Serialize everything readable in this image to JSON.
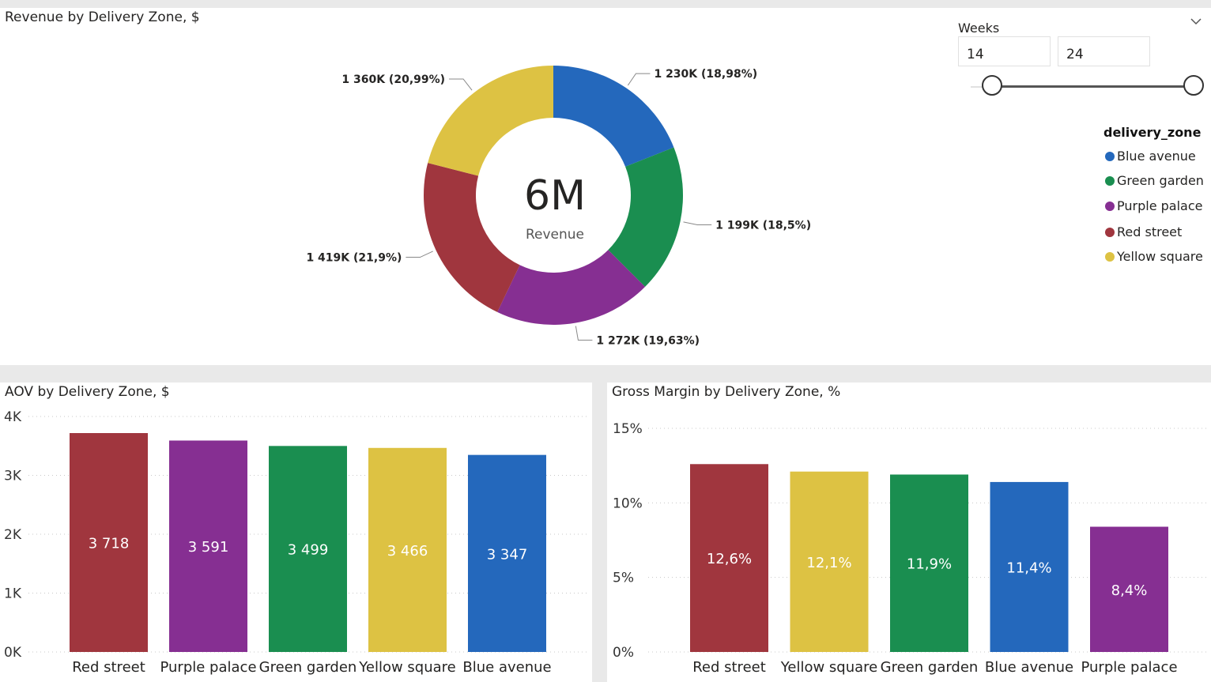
{
  "colors": {
    "blue": "#2468bc",
    "green": "#1a8e50",
    "purple": "#862f92",
    "red": "#a0363e",
    "yellow": "#ddc243"
  },
  "weeks_filter": {
    "title": "Weeks",
    "from": "14",
    "to": "24",
    "icon": "chevron-down-icon"
  },
  "legend": {
    "title": "delivery_zone",
    "items": [
      "Blue avenue",
      "Green garden",
      "Purple palace",
      "Red street",
      "Yellow square"
    ]
  },
  "chart_data": [
    {
      "type": "pie",
      "title": "Revenue by Delivery Zone, $",
      "center_value": "6M",
      "center_label": "Revenue",
      "categories": [
        "Blue avenue",
        "Green garden",
        "Purple palace",
        "Red street",
        "Yellow square"
      ],
      "values": [
        1230,
        1199,
        1272,
        1419,
        1360
      ],
      "unit": "K",
      "data_labels": [
        "1 230K (18,98%)",
        "1 199K (18,5%)",
        "1 272K (19,63%)",
        "1 419K (21,9%)",
        "1 360K (20,99%)"
      ],
      "percentages": [
        18.98,
        18.5,
        19.63,
        21.9,
        20.99
      ],
      "colors": [
        "#2468bc",
        "#1a8e50",
        "#862f92",
        "#a0363e",
        "#ddc243"
      ]
    },
    {
      "type": "bar",
      "title": "AOV by Delivery Zone, $",
      "categories": [
        "Red street",
        "Purple palace",
        "Green garden",
        "Yellow square",
        "Blue avenue"
      ],
      "values": [
        3718,
        3591,
        3499,
        3466,
        3347
      ],
      "data_labels": [
        "3 718",
        "3 591",
        "3 499",
        "3 466",
        "3 347"
      ],
      "colors": [
        "#a0363e",
        "#862f92",
        "#1a8e50",
        "#ddc243",
        "#2468bc"
      ],
      "ylim": [
        0,
        4000
      ],
      "yticks": [
        0,
        1000,
        2000,
        3000,
        4000
      ],
      "ytick_labels": [
        "0K",
        "1K",
        "2K",
        "3K",
        "4K"
      ],
      "grid": true
    },
    {
      "type": "bar",
      "title": "Gross Margin by Delivery Zone, %",
      "categories": [
        "Red street",
        "Yellow square",
        "Green garden",
        "Blue avenue",
        "Purple palace"
      ],
      "values": [
        12.6,
        12.1,
        11.9,
        11.4,
        8.4
      ],
      "data_labels": [
        "12,6%",
        "12,1%",
        "11,9%",
        "11,4%",
        "8,4%"
      ],
      "colors": [
        "#a0363e",
        "#ddc243",
        "#1a8e50",
        "#2468bc",
        "#862f92"
      ],
      "ylim": [
        0,
        15
      ],
      "yticks": [
        0,
        5,
        10,
        15
      ],
      "ytick_labels": [
        "0%",
        "5%",
        "10%",
        "15%"
      ],
      "grid": true
    }
  ]
}
